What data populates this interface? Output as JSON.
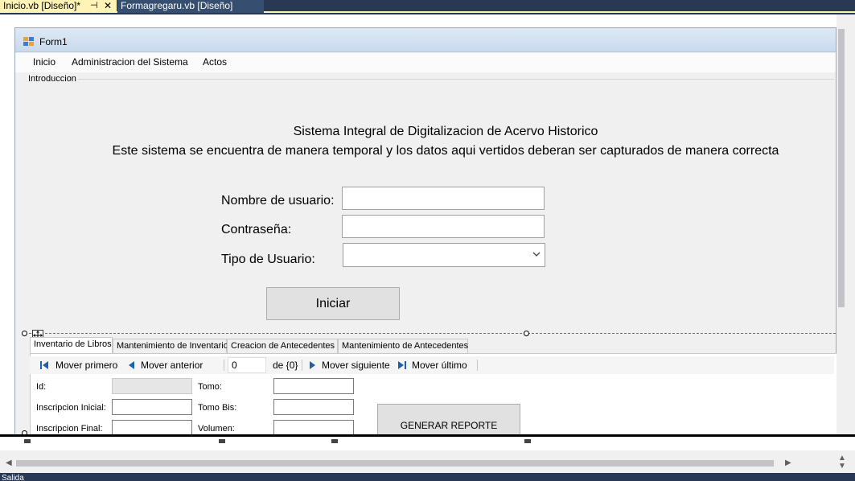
{
  "ide": {
    "tabs": [
      {
        "label": "Inicio.vb [Diseño]*",
        "active": true
      },
      {
        "label": "Formagregaru.vb [Diseño]",
        "active": false
      }
    ],
    "pin_glyph": "⊣",
    "close_glyph": "✕",
    "output_label": "Salida"
  },
  "form": {
    "title": "Form1",
    "menu": [
      "Inicio",
      "Administracion del Sistema",
      "Actos"
    ],
    "groupbox_label": "Introduccion",
    "heading_line1": "Sistema Integral de Digitalizacion de Acervo Historico",
    "heading_line2": "Este sistema se encuentra de manera temporal  y los datos aqui vertidos deberan ser capturados de manera correcta",
    "login": {
      "username_label": "Nombre de usuario:",
      "password_label": "Contraseña:",
      "usertype_label": "Tipo de Usuario:",
      "username_value": "",
      "password_value": "",
      "usertype_value": "",
      "submit_label": "Iniciar"
    },
    "tab_control": {
      "tabs": [
        "Inventario de Libros",
        "Mantenimiento de Inventario",
        "Creacion de Antecedentes",
        "Mantenimiento de Antecedentes"
      ],
      "active_tab": 0
    },
    "navigator": {
      "first": "Mover primero",
      "prev": "Mover anterior",
      "position": "0",
      "count": "de {0}",
      "next": "Mover siguiente",
      "last": "Mover último"
    },
    "record": {
      "id_label": "Id:",
      "insc_inicial_label": "Inscripcion Inicial:",
      "insc_final_label": "Inscripcion Final:",
      "tomo_label": "Tomo:",
      "tomo_bis_label": "Tomo Bis:",
      "volumen_label": "Volumen:",
      "report_button": "GENERAR REPORTE"
    }
  },
  "colors": {
    "ide_background": "#293955",
    "active_tab": "#fff3b5",
    "form_background": "#f0f0f0",
    "nav_icon": "#1e5fb4"
  }
}
